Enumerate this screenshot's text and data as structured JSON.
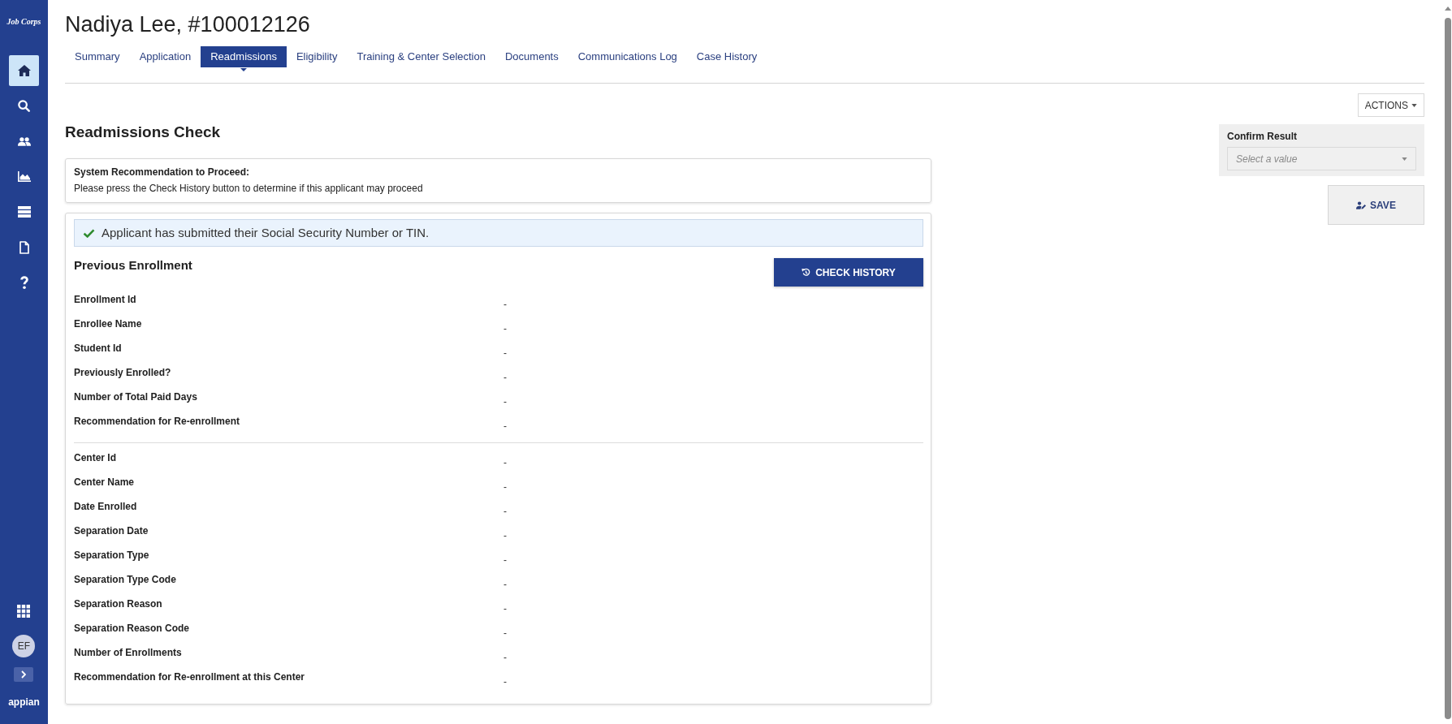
{
  "sidebar": {
    "logo": "Job Corps",
    "nav_items": [
      {
        "kind": "home",
        "selected": true
      },
      {
        "kind": "search",
        "selected": false
      },
      {
        "kind": "people",
        "selected": false
      },
      {
        "kind": "chart",
        "selected": false
      },
      {
        "kind": "list",
        "selected": false
      },
      {
        "kind": "document",
        "selected": false
      },
      {
        "kind": "help",
        "selected": false
      }
    ],
    "avatar": "EF",
    "brand": "appian"
  },
  "header": {
    "title": "Nadiya Lee, #100012126",
    "tabs": [
      {
        "label": "Summary",
        "selected": false
      },
      {
        "label": "Application",
        "selected": false
      },
      {
        "label": "Readmissions",
        "selected": true
      },
      {
        "label": "Eligibility",
        "selected": false
      },
      {
        "label": "Training & Center Selection",
        "selected": false
      },
      {
        "label": "Documents",
        "selected": false
      },
      {
        "label": "Communications Log",
        "selected": false
      },
      {
        "label": "Case History",
        "selected": false
      }
    ]
  },
  "actions_button": "ACTIONS",
  "readmissions_check": {
    "title": "Readmissions Check",
    "recommendation": {
      "label": "System Recommendation to Proceed:",
      "text": "Please press the Check History button to determine if this applicant may proceed"
    },
    "notice": "Applicant has submitted their Social Security Number or TIN.",
    "previous_enrollment": {
      "title": "Previous Enrollment",
      "button": "CHECK HISTORY",
      "groups": [
        {
          "fields": [
            {
              "label": "Enrollment Id",
              "value": "-"
            },
            {
              "label": "Enrollee Name",
              "value": "-"
            },
            {
              "label": "Student Id",
              "value": "-"
            },
            {
              "label": "Previously Enrolled?",
              "value": "-"
            },
            {
              "label": "Number of Total Paid Days",
              "value": "-"
            },
            {
              "label": "Recommendation for Re-enrollment",
              "value": "-"
            }
          ]
        },
        {
          "fields": [
            {
              "label": "Center Id",
              "value": "-"
            },
            {
              "label": "Center Name",
              "value": "-"
            },
            {
              "label": "Date Enrolled",
              "value": "-"
            },
            {
              "label": "Separation Date",
              "value": "-"
            },
            {
              "label": "Separation Type",
              "value": "-"
            },
            {
              "label": "Separation Type Code",
              "value": "-"
            },
            {
              "label": "Separation Reason",
              "value": "-"
            },
            {
              "label": "Separation Reason Code",
              "value": "-"
            },
            {
              "label": "Number of Enrollments",
              "value": "-"
            },
            {
              "label": "Recommendation for Re-enrollment at this Center",
              "value": "-"
            }
          ]
        }
      ]
    }
  },
  "confirm_result": {
    "label": "Confirm Result",
    "placeholder": "Select a value"
  },
  "save_button": "SAVE"
}
